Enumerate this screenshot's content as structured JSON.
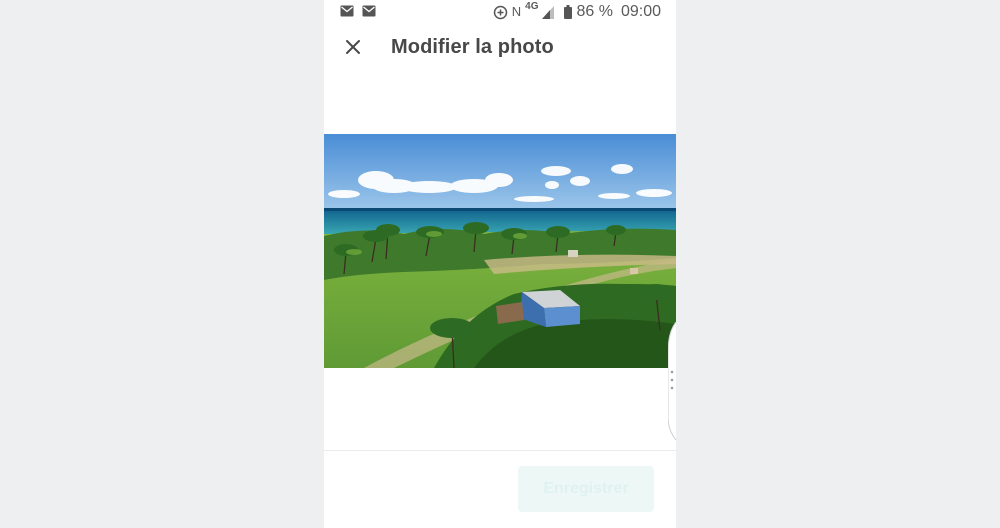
{
  "status_bar": {
    "battery_percent": "86 %",
    "time": "09:00",
    "network_label": "4G",
    "nfc_label": "N",
    "icons": [
      "mail-icon",
      "mail-icon",
      "data-saver-icon",
      "nfc-icon",
      "network-4g-icon",
      "signal-icon",
      "battery-icon"
    ]
  },
  "toolbar": {
    "close_icon": "close-icon",
    "title": "Modifier la photo"
  },
  "photo": {
    "description_icon": "photo-image"
  },
  "footer": {
    "save_label": "Enregistrer",
    "save_enabled": false
  },
  "colors": {
    "background": "#eeeff1",
    "title": "#484848",
    "save_button_disabled_bg": "#edf8f6",
    "save_button_disabled_text": "#dff2ef"
  }
}
